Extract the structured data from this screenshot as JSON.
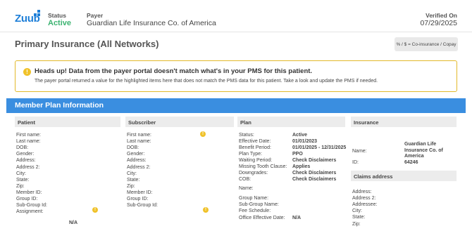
{
  "header": {
    "logo_text": "Zuub",
    "status_label": "Status",
    "status_value": "Active",
    "payer_label": "Payer",
    "payer_value": "Guardian Life Insurance Co. of America",
    "verified_label": "Verified On",
    "verified_value": "07/29/2025"
  },
  "title": "Primary Insurance (All Networks)",
  "legend": "% / $ = Co-insurance / Copay",
  "alert": {
    "icon": "!",
    "title": "Heads up! Data from the payer portal doesn't match what's in your PMS for this patient.",
    "body": "The payer portal returned a value for the highlighted items here that does not match the PMS data for this patient. Take a look and update the PMS if needed."
  },
  "section_title": "Member Plan Information",
  "patient": {
    "heading": "Patient",
    "labels": [
      "First name:",
      "Last name:",
      "DOB:",
      "Gender:",
      "Address:",
      "Address 2:",
      "City:",
      "State:",
      "Zip:",
      "Member ID:",
      "Group ID:",
      "Sub-Group Id:",
      "Assignment:"
    ],
    "assignment_value": "N/A"
  },
  "subscriber": {
    "heading": "Subscriber",
    "labels": [
      "First name:",
      "Last name:",
      "DOB:",
      "Gender:",
      "Address:",
      "Address 2:",
      "City:",
      "State:",
      "Zip:",
      "Member ID:",
      "Group ID:",
      "Sub-Group Id:"
    ]
  },
  "plan": {
    "heading": "Plan",
    "labels": [
      "Status:",
      "Effective Date:",
      "Benefit Period:",
      "Plan Type:",
      "Waiting Period:",
      "Missing Tooth Clause:",
      "Downgrades:",
      "COB:",
      "Name:",
      "Group Name:",
      "Sub-Group Name:",
      "Fee Schedule:",
      "Office Effective Date:"
    ],
    "values": [
      "Active",
      "01/01/2023",
      "01/01/2025 - 12/31/2025",
      "PPO",
      "Check Disclaimers",
      "Applies",
      "Check Disclaimers",
      "Check Disclaimers",
      "",
      "",
      "",
      "",
      "N/A"
    ]
  },
  "insurance": {
    "heading": "Insurance",
    "name_label": "Name:",
    "name_value": "Guardian Life Insurance Co. of America",
    "id_label": "ID:",
    "id_value": "64246",
    "claims_heading": "Claims address",
    "claims_labels": [
      "Address:",
      "Address 2:",
      "Addressee:",
      "City:",
      "State:",
      "Zip:"
    ]
  },
  "colors": {
    "accent": "#3a8ee0",
    "status_active": "#3cb371",
    "warning": "#f0c22a"
  }
}
